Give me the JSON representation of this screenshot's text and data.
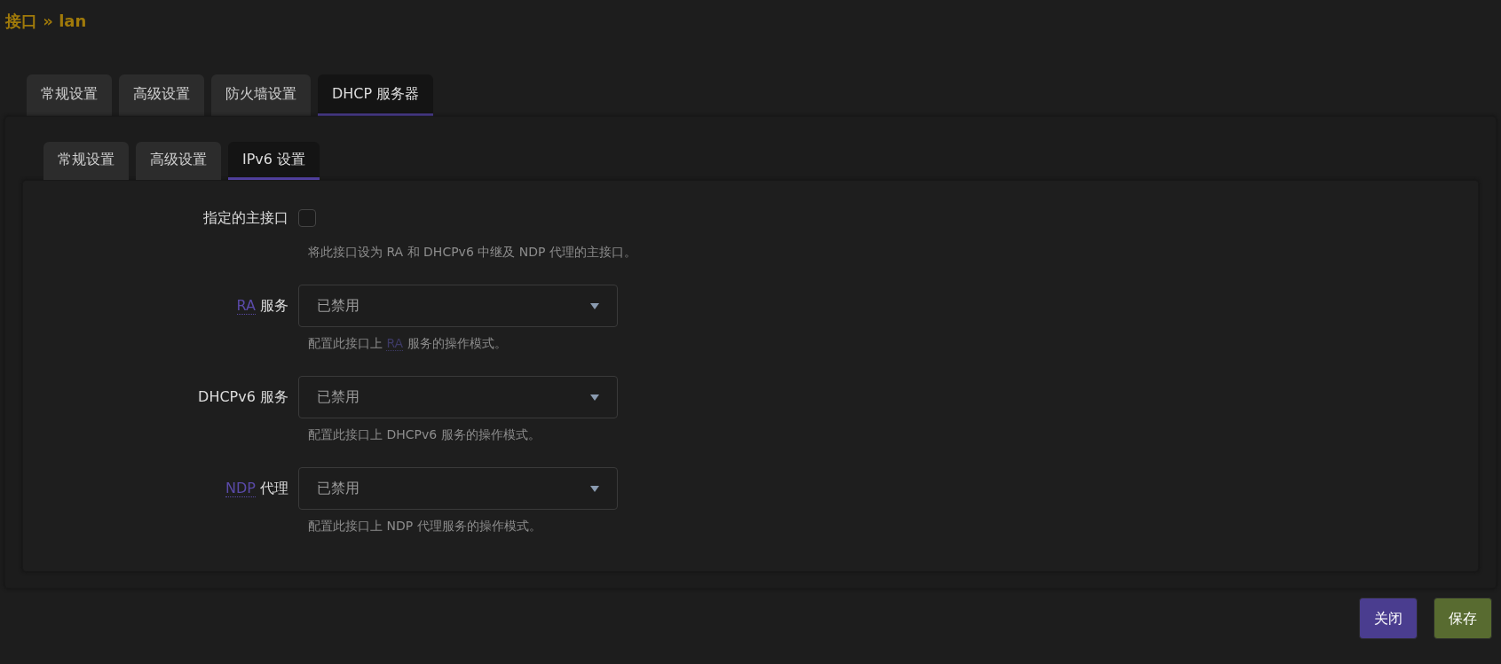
{
  "page_title": "接口 » lan",
  "tabs": [
    {
      "label": "常规设置",
      "selected": false
    },
    {
      "label": "高级设置",
      "selected": false
    },
    {
      "label": "防火墙设置",
      "selected": false
    },
    {
      "label": "DHCP 服务器",
      "selected": true
    }
  ],
  "sub_tabs": [
    {
      "label": "常规设置",
      "selected": false
    },
    {
      "label": "高级设置",
      "selected": false
    },
    {
      "label": "IPv6 设置",
      "selected": true
    }
  ],
  "fields": [
    {
      "kind": "checkbox",
      "label": [
        {
          "text": "指定的主接口"
        }
      ],
      "checked": false,
      "description": [
        {
          "text": "将此接口设为 RA 和 DHCPv6 中继及 NDP 代理的主接口。"
        }
      ]
    },
    {
      "kind": "select",
      "label": [
        {
          "text": "RA",
          "abbr": true
        },
        {
          "text": "服务"
        }
      ],
      "value": "已禁用",
      "description": [
        {
          "text": "配置此接口上 "
        },
        {
          "text": "RA",
          "abbr": true
        },
        {
          "text": " 服务的操作模式。"
        }
      ]
    },
    {
      "kind": "select",
      "label": [
        {
          "text": "DHCPv6 服务"
        }
      ],
      "value": "已禁用",
      "description": [
        {
          "text": "配置此接口上 DHCPv6 服务的操作模式。"
        }
      ]
    },
    {
      "kind": "select",
      "label": [
        {
          "text": "NDP",
          "abbr": true
        },
        {
          "text": "代理"
        }
      ],
      "value": "已禁用",
      "description": [
        {
          "text": "配置此接口上 NDP 代理服务的操作模式。"
        }
      ]
    }
  ],
  "buttons": [
    {
      "label": "关闭",
      "kind": "dismiss"
    },
    {
      "label": "保存",
      "kind": "save"
    }
  ]
}
